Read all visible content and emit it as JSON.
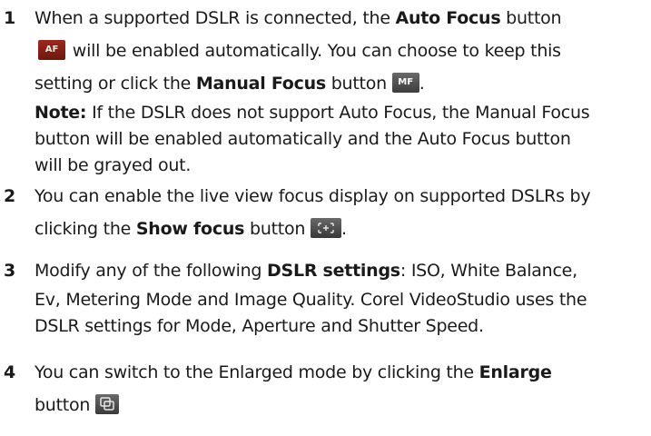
{
  "steps": [
    {
      "number": "1",
      "l1_a": "When a supported DSLR is connected, the ",
      "l1_b": "Auto Focus",
      "l1_c": " button",
      "af_icon_text": "AF",
      "l2_a": " will be enabled automatically. You can choose to keep this",
      "l3_a": "setting or click the ",
      "l3_b": "Manual Focus",
      "l3_c": " button ",
      "mf_icon_text": "MF",
      "l3_d": ".",
      "note_label": "Note:",
      "note_l1": "  If the DSLR does not support Auto Focus, the Manual Focus",
      "note_l2": "button will be enabled automatically and the Auto Focus button",
      "note_l3": "will be grayed out."
    },
    {
      "number": "2",
      "l1_a": "You can enable the live view focus display on supported DSLRs by",
      "l2_a": "clicking the ",
      "l2_b": "Show focus",
      "l2_c": " button ",
      "l2_d": "."
    },
    {
      "number": "3",
      "l1_a": "Modify any of the following ",
      "l1_b": "DSLR settings",
      "l1_c": ": ISO, White Balance,",
      "l2_a": "Ev, Metering Mode and Image Quality. Corel VideoStudio uses the",
      "l3_a": "DSLR settings for Mode, Aperture and Shutter Speed."
    },
    {
      "number": "4",
      "l1_a": "You can switch to the Enlarged mode by clicking the ",
      "l1_b": "Enlarge",
      "l2_a": "button "
    }
  ]
}
